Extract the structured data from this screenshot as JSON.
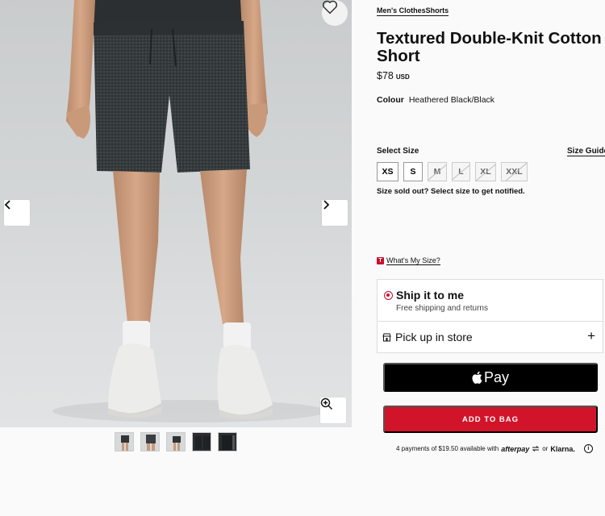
{
  "breadcrumb": {
    "text": "Men's ClothesShorts"
  },
  "product": {
    "title": "Textured Double-Knit Cotton Short",
    "price": "$78",
    "currency": "USD",
    "colour_label": "Colour",
    "colour_value": "Heathered Black/Black"
  },
  "size": {
    "label": "Select Size",
    "guide": "Size Guide",
    "options": [
      {
        "label": "XS",
        "sold_out": false
      },
      {
        "label": "S",
        "sold_out": false
      },
      {
        "label": "M",
        "sold_out": true
      },
      {
        "label": "L",
        "sold_out": true
      },
      {
        "label": "XL",
        "sold_out": true
      },
      {
        "label": "XXL",
        "sold_out": true
      }
    ],
    "note": "Size sold out? Select size to get notified.",
    "whats_my_size": "What's My Size?",
    "whats_my_size_badge": "T"
  },
  "delivery": {
    "ship_title": "Ship it to me",
    "ship_subtitle": "Free shipping and returns",
    "pickup_title": "Pick up in store",
    "pickup_toggle": "+"
  },
  "payment": {
    "apple_pay_label": "Pay",
    "add_to_bag": "ADD TO BAG",
    "installments_text": "4 payments of $19.50 available with",
    "afterpay": "afterpay",
    "or": "or",
    "klarna": "Klarna.",
    "info": "i"
  },
  "gallery": {
    "thumbnail_count": 5,
    "icons": [
      "heart-icon",
      "chevron-left-icon",
      "chevron-right-icon",
      "zoom-in-icon"
    ]
  },
  "colors": {
    "brand_red": "#d2142a",
    "apple_pay_black": "#000000",
    "short_fabric": "#33383a"
  }
}
